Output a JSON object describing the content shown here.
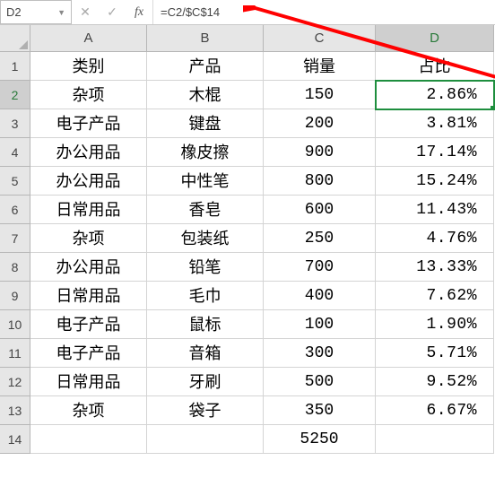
{
  "formula_bar": {
    "name_box": "D2",
    "formula": "=C2/$C$14"
  },
  "col_headers": [
    "A",
    "B",
    "C",
    "D"
  ],
  "header_row": {
    "cat": "类别",
    "prod": "产品",
    "sales": "销量",
    "pct": "占比"
  },
  "rows": [
    {
      "cat": "杂项",
      "prod": "木棍",
      "sales": "150",
      "pct": "2.86%"
    },
    {
      "cat": "电子产品",
      "prod": "键盘",
      "sales": "200",
      "pct": "3.81%"
    },
    {
      "cat": "办公用品",
      "prod": "橡皮擦",
      "sales": "900",
      "pct": "17.14%"
    },
    {
      "cat": "办公用品",
      "prod": "中性笔",
      "sales": "800",
      "pct": "15.24%"
    },
    {
      "cat": "日常用品",
      "prod": "香皂",
      "sales": "600",
      "pct": "11.43%"
    },
    {
      "cat": "杂项",
      "prod": "包装纸",
      "sales": "250",
      "pct": "4.76%"
    },
    {
      "cat": "办公用品",
      "prod": "铅笔",
      "sales": "700",
      "pct": "13.33%"
    },
    {
      "cat": "日常用品",
      "prod": "毛巾",
      "sales": "400",
      "pct": "7.62%"
    },
    {
      "cat": "电子产品",
      "prod": "鼠标",
      "sales": "100",
      "pct": "1.90%"
    },
    {
      "cat": "电子产品",
      "prod": "音箱",
      "sales": "300",
      "pct": "5.71%"
    },
    {
      "cat": "日常用品",
      "prod": "牙刷",
      "sales": "500",
      "pct": "9.52%"
    },
    {
      "cat": "杂项",
      "prod": "袋子",
      "sales": "350",
      "pct": "6.67%"
    }
  ],
  "total_row": {
    "sales": "5250"
  },
  "selected_cell": "D2",
  "chart_data": {
    "type": "table",
    "columns": [
      "类别",
      "产品",
      "销量",
      "占比"
    ],
    "rows": [
      [
        "杂项",
        "木棍",
        150,
        "2.86%"
      ],
      [
        "电子产品",
        "键盘",
        200,
        "3.81%"
      ],
      [
        "办公用品",
        "橡皮擦",
        900,
        "17.14%"
      ],
      [
        "办公用品",
        "中性笔",
        800,
        "15.24%"
      ],
      [
        "日常用品",
        "香皂",
        600,
        "11.43%"
      ],
      [
        "杂项",
        "包装纸",
        250,
        "4.76%"
      ],
      [
        "办公用品",
        "铅笔",
        700,
        "13.33%"
      ],
      [
        "日常用品",
        "毛巾",
        400,
        "7.62%"
      ],
      [
        "电子产品",
        "鼠标",
        100,
        "1.90%"
      ],
      [
        "电子产品",
        "音箱",
        300,
        "5.71%"
      ],
      [
        "日常用品",
        "牙刷",
        500,
        "9.52%"
      ],
      [
        "杂项",
        "袋子",
        350,
        "6.67%"
      ]
    ],
    "total_sales": 5250
  }
}
